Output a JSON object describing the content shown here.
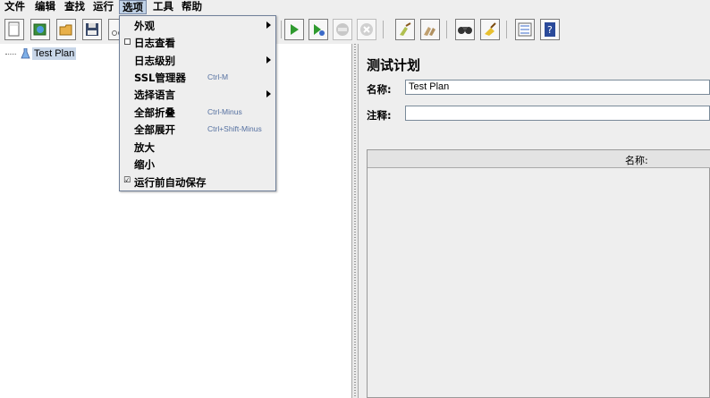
{
  "menubar": {
    "items": [
      {
        "label": "文件"
      },
      {
        "label": "编辑"
      },
      {
        "label": "查找"
      },
      {
        "label": "运行"
      },
      {
        "label": "选项"
      },
      {
        "label": "工具"
      },
      {
        "label": "帮助"
      }
    ]
  },
  "options_menu": {
    "items": [
      {
        "label": "外观",
        "shortcut": "",
        "submenu": true
      },
      {
        "label": "日志查看",
        "shortcut": "",
        "checkbox": "unchecked"
      },
      {
        "label": "日志级别",
        "shortcut": "",
        "submenu": true
      },
      {
        "label": "SSL管理器",
        "shortcut": "Ctrl-M"
      },
      {
        "label": "选择语言",
        "shortcut": "",
        "submenu": true
      },
      {
        "label": "全部折叠",
        "shortcut": "Ctrl-Minus"
      },
      {
        "label": "全部展开",
        "shortcut": "Ctrl+Shift-Minus"
      },
      {
        "label": "放大",
        "shortcut": ""
      },
      {
        "label": "缩小",
        "shortcut": ""
      },
      {
        "label": "运行前自动保存",
        "shortcut": "",
        "checkbox": "checked"
      }
    ]
  },
  "toolbar": {
    "buttons": [
      "new-icon",
      "templates-icon",
      "open-icon",
      "save-icon",
      "start-icon",
      "start-no-pause-icon",
      "stop-icon",
      "shutdown-icon",
      "clear-icon",
      "clear-all-icon",
      "search-icon",
      "reset-search-icon",
      "function-helper-icon",
      "help-icon"
    ]
  },
  "tree": {
    "root_label": "Test Plan"
  },
  "panel": {
    "title": "测试计划",
    "name_label": "名称:",
    "name_value": "Test Plan",
    "comment_label": "注释:",
    "comment_value": "",
    "table_column": "名称:"
  },
  "colors": {
    "background": "#eeeeee",
    "menu_highlight": "#bfd1e6",
    "underline_accent": "#e00000",
    "selection": "#c8d6e8",
    "shortcut_text": "#5570a0"
  }
}
